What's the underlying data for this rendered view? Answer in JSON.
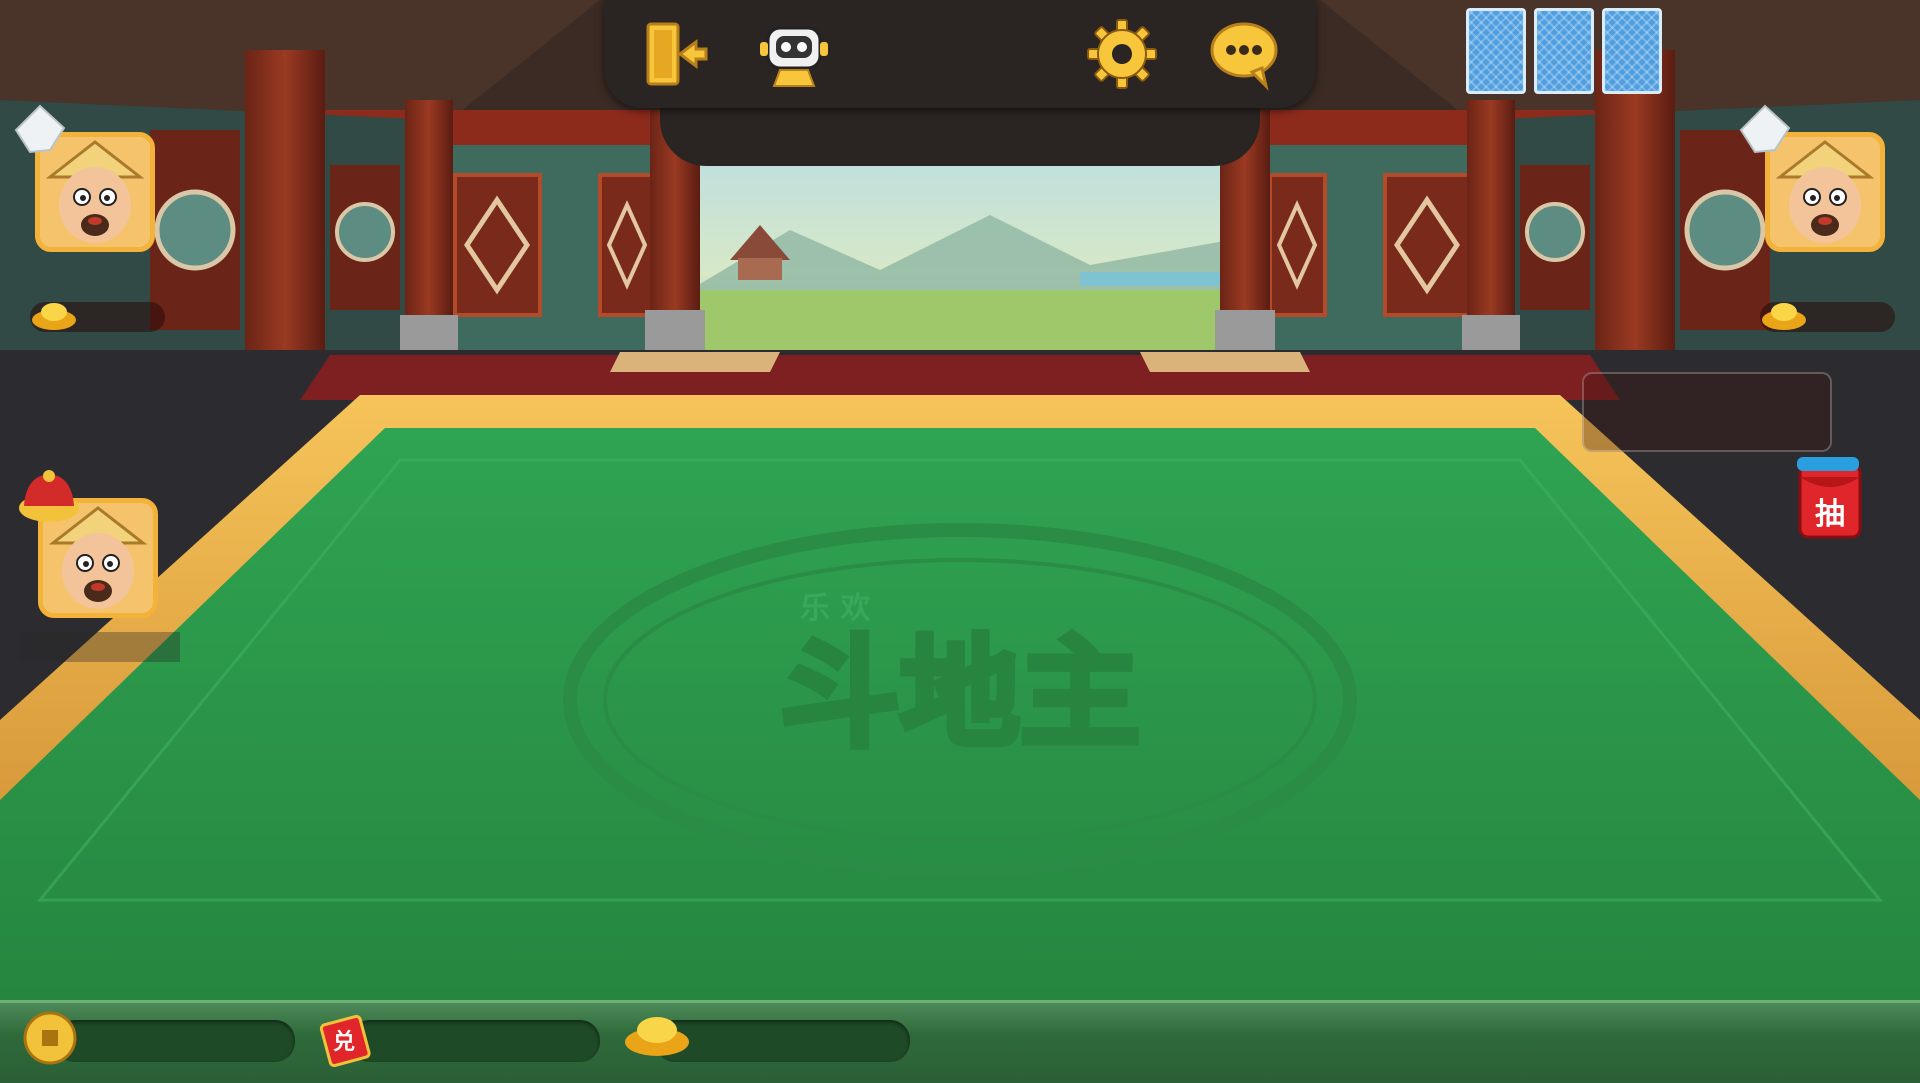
{
  "game": {
    "name": "欢乐斗地主",
    "table_logo_small": "乐 欢",
    "table_logo_main": "斗地主"
  },
  "toolbar": {
    "buttons": [
      {
        "id": "exit",
        "icon": "exit-door-icon"
      },
      {
        "id": "robot",
        "icon": "robot-autoplay-icon"
      },
      {
        "id": "settings",
        "icon": "gear-icon"
      },
      {
        "id": "chat",
        "icon": "chat-bubble-icon"
      }
    ],
    "hidden_cards": 3
  },
  "players": [
    {
      "seat": "left-top",
      "role": "peasant",
      "hat": "white-towel"
    },
    {
      "seat": "right-top",
      "role": "peasant",
      "hat": "white-towel"
    },
    {
      "seat": "left-self",
      "role": "landlord",
      "hat": "red-landlord-hat"
    }
  ],
  "lottery_button": {
    "label": "抽"
  },
  "bottom_bar": {
    "coin_icon": "coin-icon",
    "ticket_icon": "scroll-ticket-icon",
    "ingot_icon": "gold-ingot-icon",
    "ticket_label": "兑"
  },
  "colors": {
    "felt": "#2e9a4d",
    "table_rim": "#e8a93a",
    "toolbar_bg": "#2a2423",
    "card_back": "#4f9fe0"
  }
}
